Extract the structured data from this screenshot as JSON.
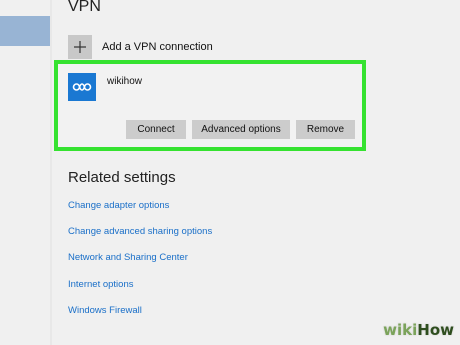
{
  "vpn": {
    "title": "VPN",
    "add_label": "Add a VPN connection",
    "add_icon": "plus-icon",
    "connection": {
      "name": "wikihow",
      "icon": "vpn-icon",
      "icon_color": "#1a78d2",
      "highlight_color": "#35e230",
      "buttons": {
        "connect": "Connect",
        "advanced": "Advanced options",
        "remove": "Remove"
      }
    }
  },
  "related": {
    "title": "Related settings",
    "links": [
      "Change adapter options",
      "Change advanced sharing options",
      "Network and Sharing Center",
      "Internet options",
      "Windows Firewall"
    ]
  },
  "watermark": {
    "part1": "wiki",
    "part2": "How"
  }
}
